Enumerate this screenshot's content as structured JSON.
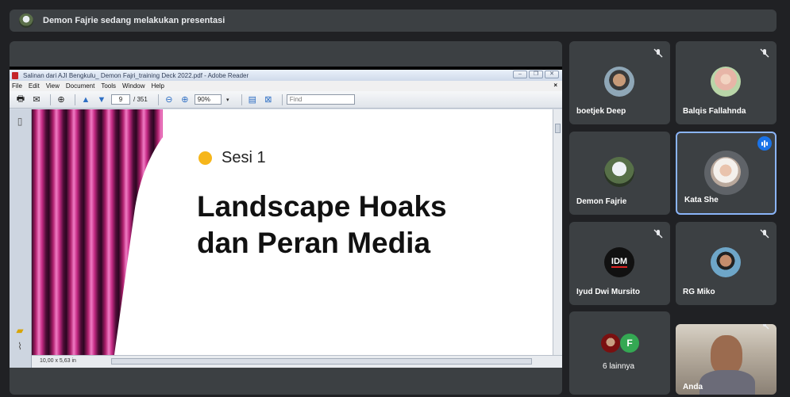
{
  "banner": {
    "text": "Demon Fajrie sedang melakukan presentasi"
  },
  "reader": {
    "title": "Salinan dari AJI Bengkulu_ Demon Fajri_training Deck 2022.pdf - Adobe Reader",
    "menu": [
      "File",
      "Edit",
      "View",
      "Document",
      "Tools",
      "Window",
      "Help"
    ],
    "page_current": "9",
    "page_total": "/ 351",
    "zoom": "90%",
    "find_placeholder": "Find",
    "page_size": "10,00 x 5,63 in"
  },
  "slide": {
    "session_label": "Sesi 1",
    "headline_line1": "Landscape Hoaks",
    "headline_line2": "dan Peran Media",
    "dot_color": "#f6b61a"
  },
  "participants": [
    {
      "name": "boetjek Deep",
      "muted": true
    },
    {
      "name": "Balqis Fallahnda",
      "muted": true
    },
    {
      "name": "Demon Fajrie",
      "muted": false
    },
    {
      "name": "Kata She",
      "muted": false,
      "speaking": true
    },
    {
      "name": "Iyud Dwi Mursito",
      "muted": true
    },
    {
      "name": "RG Miko",
      "muted": true
    },
    {
      "name": "6 lainnya",
      "muted": false
    },
    {
      "name": "Anda",
      "muted": true
    }
  ],
  "more_avatar_letter": "F",
  "logo_text": "IDM",
  "colors": {
    "bg": "#202124",
    "tile": "#3c4043",
    "accent": "#8ab4f8",
    "speaking": "#1a73e8"
  }
}
